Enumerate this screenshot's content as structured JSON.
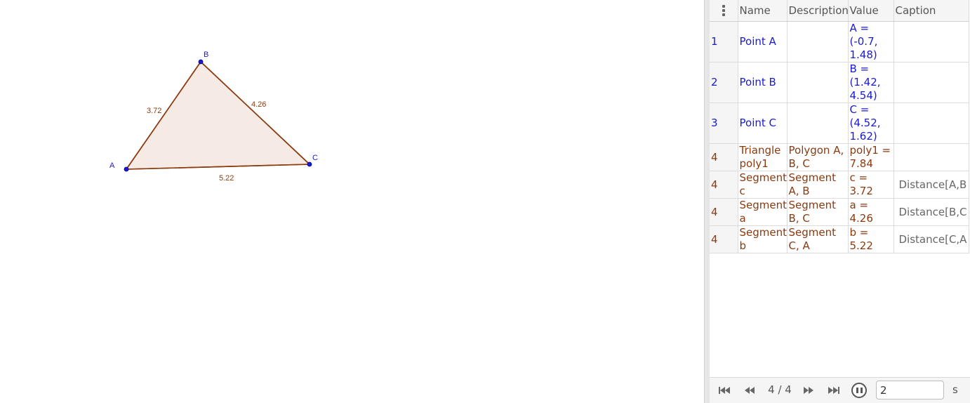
{
  "graphics": {
    "points": [
      {
        "name": "A",
        "x": -0.7,
        "y": 1.48
      },
      {
        "name": "B",
        "x": 1.42,
        "y": 4.54
      },
      {
        "name": "C",
        "x": 4.52,
        "y": 1.62
      }
    ],
    "segment_labels": {
      "c": "3.72",
      "a": "4.26",
      "b": "5.22"
    },
    "colors": {
      "point": "#1a1ad4",
      "polygon_stroke": "#8b3a0f",
      "polygon_fill": "#f5e6e0"
    }
  },
  "protocol": {
    "columns": {
      "name": "Name",
      "description": "Description",
      "value": "Value",
      "caption": "Caption"
    },
    "rows": [
      {
        "num": "1",
        "name": "Point A",
        "description": "",
        "value": "A = (-0.7, 1.48)",
        "caption": ""
      },
      {
        "num": "2",
        "name": "Point B",
        "description": "",
        "value": "B = (1.42, 4.54)",
        "caption": ""
      },
      {
        "num": "3",
        "name": "Point C",
        "description": "",
        "value": "C = (4.52, 1.62)",
        "caption": ""
      },
      {
        "num": "4",
        "name": "Triangle poly1",
        "description": "Polygon A, B, C",
        "value": "poly1 = 7.84",
        "caption": ""
      },
      {
        "num": "4",
        "name": "Segment c",
        "description": "Segment A, B",
        "value": "c = 3.72",
        "caption": "Distance[A,B"
      },
      {
        "num": "4",
        "name": "Segment a",
        "description": "Segment B, C",
        "value": "a = 4.26",
        "caption": "Distance[B,C"
      },
      {
        "num": "4",
        "name": "Segment b",
        "description": "Segment C, A",
        "value": "b = 5.22",
        "caption": "Distance[C,A"
      }
    ]
  },
  "navigation": {
    "step": "4 / 4",
    "speed_value": "2",
    "speed_unit": "s"
  }
}
